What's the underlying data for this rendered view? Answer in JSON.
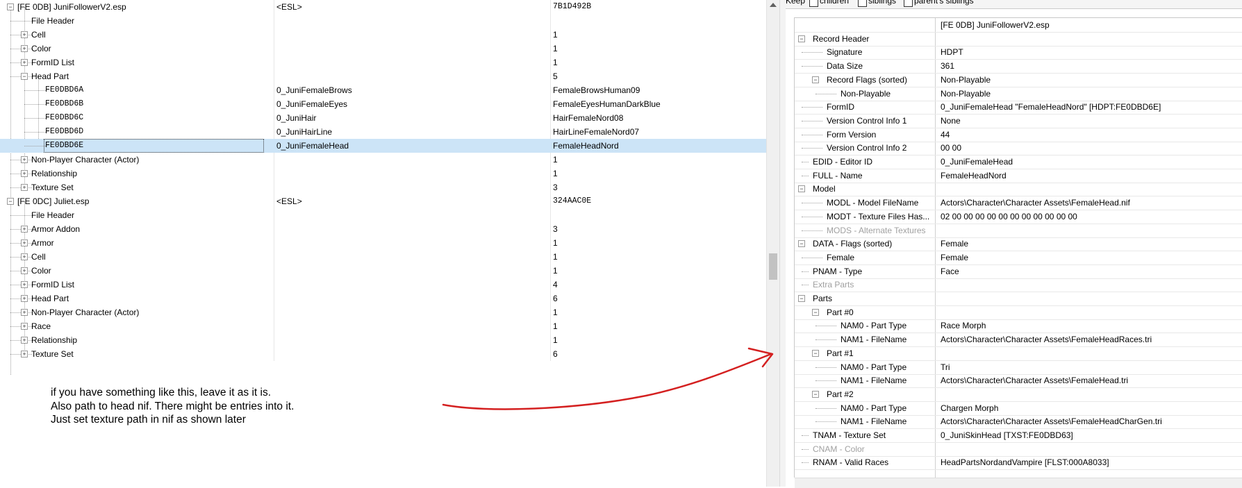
{
  "left_tree": {
    "rows": [
      {
        "name": "[FE 0DB] JuniFollowerV2.esp",
        "col2": "<ESL>",
        "col3": "7B1D492B",
        "level": 0,
        "expander": "-",
        "mono3": true
      },
      {
        "name": "File Header",
        "col2": "",
        "col3": "",
        "level": 1,
        "expander": ""
      },
      {
        "name": "Cell",
        "col2": "",
        "col3": "1",
        "level": 1,
        "expander": "+"
      },
      {
        "name": "Color",
        "col2": "",
        "col3": "1",
        "level": 1,
        "expander": "+"
      },
      {
        "name": "FormID List",
        "col2": "",
        "col3": "1",
        "level": 1,
        "expander": "+"
      },
      {
        "name": "Head Part",
        "col2": "",
        "col3": "5",
        "level": 1,
        "expander": "-"
      },
      {
        "name": "FE0DBD6A",
        "col2": "0_JuniFemaleBrows",
        "col3": "FemaleBrowsHuman09",
        "level": 2,
        "expander": "",
        "mono1": true
      },
      {
        "name": "FE0DBD6B",
        "col2": "0_JuniFemaleEyes",
        "col3": "FemaleEyesHumanDarkBlue",
        "level": 2,
        "expander": "",
        "mono1": true
      },
      {
        "name": "FE0DBD6C",
        "col2": "0_JuniHair",
        "col3": "HairFemaleNord08",
        "level": 2,
        "expander": "",
        "mono1": true
      },
      {
        "name": "FE0DBD6D",
        "col2": "0_JuniHairLine",
        "col3": "HairLineFemaleNord07",
        "level": 2,
        "expander": "",
        "mono1": true
      },
      {
        "name": "FE0DBD6E",
        "col2": "0_JuniFemaleHead",
        "col3": "FemaleHeadNord",
        "level": 2,
        "expander": "",
        "mono1": true,
        "selected": true
      },
      {
        "name": "Non-Player Character (Actor)",
        "col2": "",
        "col3": "1",
        "level": 1,
        "expander": "+"
      },
      {
        "name": "Relationship",
        "col2": "",
        "col3": "1",
        "level": 1,
        "expander": "+"
      },
      {
        "name": "Texture Set",
        "col2": "",
        "col3": "3",
        "level": 1,
        "expander": "+"
      },
      {
        "name": "[FE 0DC] Juliet.esp",
        "col2": "<ESL>",
        "col3": "324AAC0E",
        "level": 0,
        "expander": "-",
        "mono3": true
      },
      {
        "name": "File Header",
        "col2": "",
        "col3": "",
        "level": 1,
        "expander": ""
      },
      {
        "name": "Armor Addon",
        "col2": "",
        "col3": "3",
        "level": 1,
        "expander": "+"
      },
      {
        "name": "Armor",
        "col2": "",
        "col3": "1",
        "level": 1,
        "expander": "+"
      },
      {
        "name": "Cell",
        "col2": "",
        "col3": "1",
        "level": 1,
        "expander": "+"
      },
      {
        "name": "Color",
        "col2": "",
        "col3": "1",
        "level": 1,
        "expander": "+"
      },
      {
        "name": "FormID List",
        "col2": "",
        "col3": "4",
        "level": 1,
        "expander": "+"
      },
      {
        "name": "Head Part",
        "col2": "",
        "col3": "6",
        "level": 1,
        "expander": "+"
      },
      {
        "name": "Non-Player Character (Actor)",
        "col2": "",
        "col3": "1",
        "level": 1,
        "expander": "+"
      },
      {
        "name": "Race",
        "col2": "",
        "col3": "1",
        "level": 1,
        "expander": "+"
      },
      {
        "name": "Relationship",
        "col2": "",
        "col3": "1",
        "level": 1,
        "expander": "+"
      },
      {
        "name": "Texture Set",
        "col2": "",
        "col3": "6",
        "level": 1,
        "expander": "+"
      }
    ]
  },
  "keep_bar": {
    "label": "Keep",
    "options": [
      "children",
      "siblings",
      "parent's siblings"
    ]
  },
  "record_view": {
    "rows": [
      {
        "name": "",
        "value": "[FE 0DB] JuniFollowerV2.esp",
        "level": 0,
        "expander": ""
      },
      {
        "name": "Record Header",
        "value": "",
        "level": 0,
        "expander": "-"
      },
      {
        "name": "Signature",
        "value": "HDPT",
        "level": 1,
        "expander": ""
      },
      {
        "name": "Data Size",
        "value": "361",
        "level": 1,
        "expander": ""
      },
      {
        "name": "Record Flags (sorted)",
        "value": "Non-Playable",
        "level": 1,
        "expander": "-"
      },
      {
        "name": "Non-Playable",
        "value": "Non-Playable",
        "level": 2,
        "expander": ""
      },
      {
        "name": "FormID",
        "value": "0_JuniFemaleHead \"FemaleHeadNord\" [HDPT:FE0DBD6E]",
        "level": 1,
        "expander": ""
      },
      {
        "name": "Version Control Info 1",
        "value": "None",
        "level": 1,
        "expander": ""
      },
      {
        "name": "Form Version",
        "value": "44",
        "level": 1,
        "expander": ""
      },
      {
        "name": "Version Control Info 2",
        "value": "00 00",
        "level": 1,
        "expander": ""
      },
      {
        "name": "EDID - Editor ID",
        "value": "0_JuniFemaleHead",
        "level": 0,
        "expander": ""
      },
      {
        "name": "FULL - Name",
        "value": "FemaleHeadNord",
        "level": 0,
        "expander": ""
      },
      {
        "name": "Model",
        "value": "",
        "level": 0,
        "expander": "-"
      },
      {
        "name": "MODL - Model FileName",
        "value": "Actors\\Character\\Character Assets\\FemaleHead.nif",
        "level": 1,
        "expander": ""
      },
      {
        "name": "MODT - Texture Files Has...",
        "value": "02 00 00 00 00 00 00 00 00 00 00 00",
        "level": 1,
        "expander": ""
      },
      {
        "name": "MODS - Alternate Textures",
        "value": "",
        "level": 1,
        "expander": "",
        "grey": true
      },
      {
        "name": "DATA - Flags (sorted)",
        "value": "Female",
        "level": 0,
        "expander": "-"
      },
      {
        "name": "Female",
        "value": "Female",
        "level": 1,
        "expander": ""
      },
      {
        "name": "PNAM - Type",
        "value": "Face",
        "level": 0,
        "expander": ""
      },
      {
        "name": "Extra Parts",
        "value": "",
        "level": 0,
        "expander": "",
        "grey": true
      },
      {
        "name": "Parts",
        "value": "",
        "level": 0,
        "expander": "-"
      },
      {
        "name": "Part #0",
        "value": "",
        "level": 1,
        "expander": "-"
      },
      {
        "name": "NAM0 - Part Type",
        "value": "Race Morph",
        "level": 2,
        "expander": ""
      },
      {
        "name": "NAM1 - FileName",
        "value": "Actors\\Character\\Character Assets\\FemaleHeadRaces.tri",
        "level": 2,
        "expander": ""
      },
      {
        "name": "Part #1",
        "value": "",
        "level": 1,
        "expander": "-"
      },
      {
        "name": "NAM0 - Part Type",
        "value": "Tri",
        "level": 2,
        "expander": ""
      },
      {
        "name": "NAM1 - FileName",
        "value": "Actors\\Character\\Character Assets\\FemaleHead.tri",
        "level": 2,
        "expander": ""
      },
      {
        "name": "Part #2",
        "value": "",
        "level": 1,
        "expander": "-"
      },
      {
        "name": "NAM0 - Part Type",
        "value": "Chargen Morph",
        "level": 2,
        "expander": ""
      },
      {
        "name": "NAM1 - FileName",
        "value": "Actors\\Character\\Character Assets\\FemaleHeadCharGen.tri",
        "level": 2,
        "expander": ""
      },
      {
        "name": "TNAM - Texture Set",
        "value": "0_JuniSkinHead [TXST:FE0DBD63]",
        "level": 0,
        "expander": ""
      },
      {
        "name": "CNAM - Color",
        "value": "",
        "level": 0,
        "expander": "",
        "grey": true
      },
      {
        "name": "RNAM - Valid Races",
        "value": "HeadPartsNordandVampire [FLST:000A8033]",
        "level": 0,
        "expander": ""
      }
    ]
  },
  "annotation": {
    "lines": [
      "if you have something like this, leave it as it is.",
      "Also path to head nif. There might be entries into it.",
      "Just set texture path in nif as shown later"
    ],
    "arrow_color": "#d42020"
  }
}
